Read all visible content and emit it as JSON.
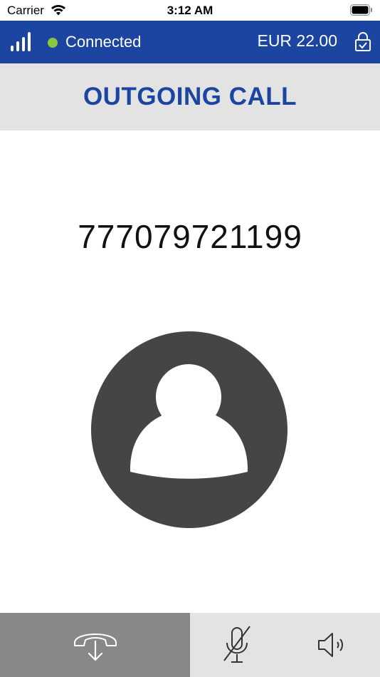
{
  "status_bar": {
    "carrier": "Carrier",
    "time": "3:12 AM"
  },
  "header": {
    "connection_status": "Connected",
    "connection_color": "#8cc63f",
    "balance": "EUR 22.00",
    "brand_color": "#1b45a0"
  },
  "call": {
    "title": "OUTGOING CALL",
    "number": "777079721199"
  },
  "controls": {
    "hangup_icon": "hangup-icon",
    "mute_icon": "microphone-muted-icon",
    "speaker_icon": "speaker-icon"
  }
}
